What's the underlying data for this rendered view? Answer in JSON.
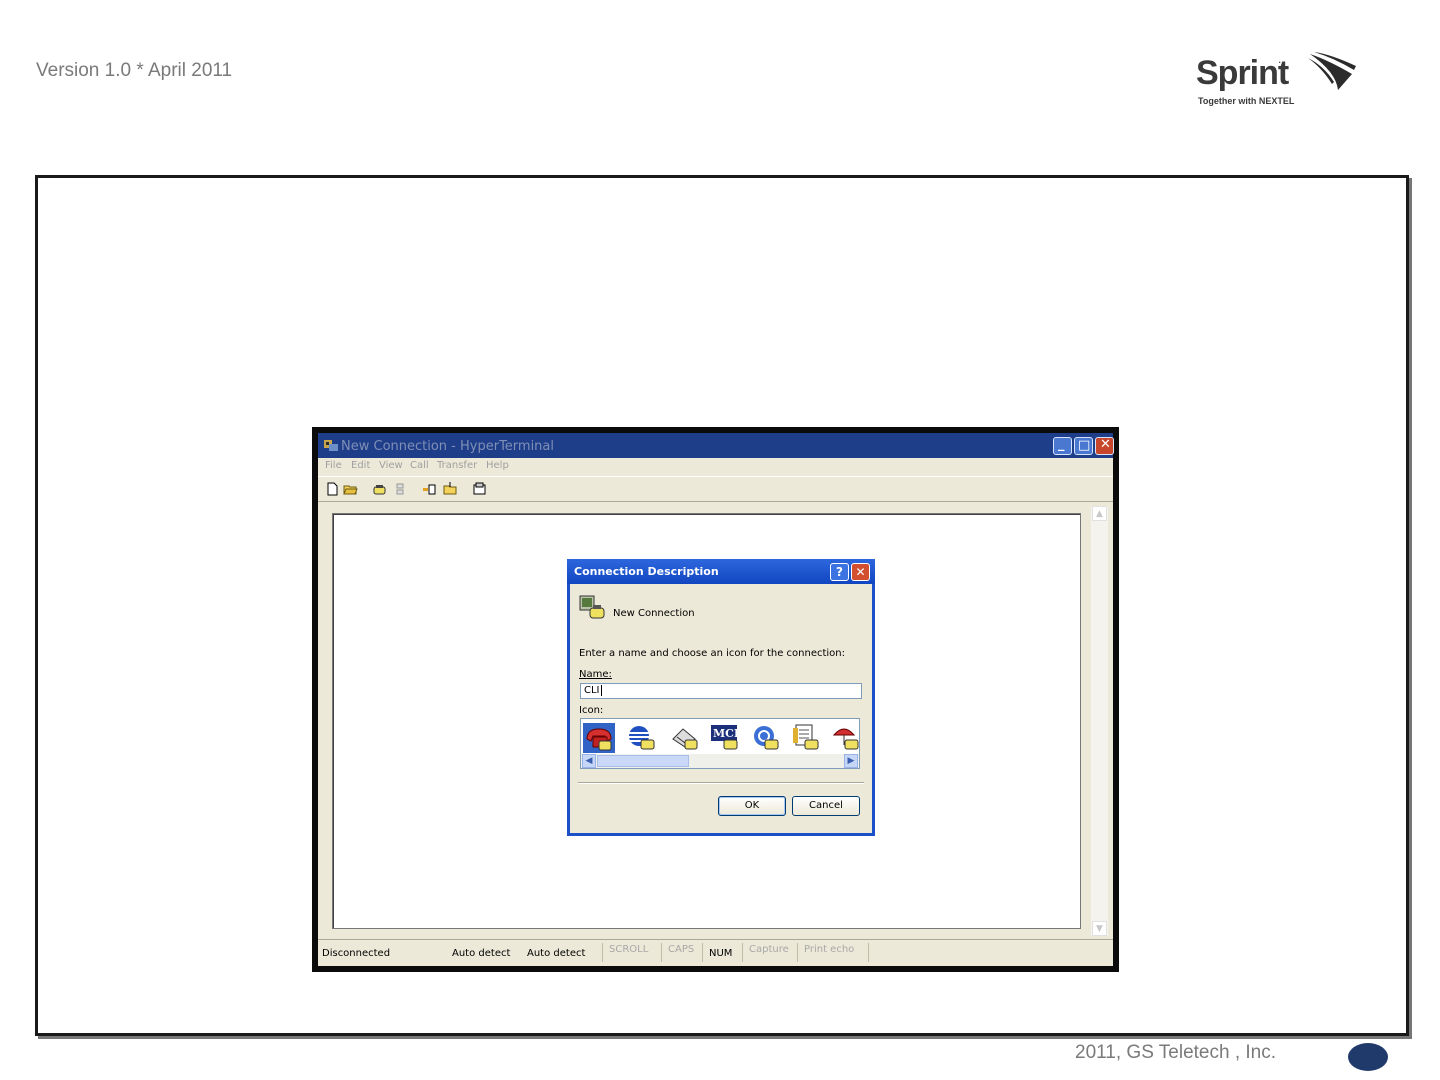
{
  "page": {
    "version_text": "Version 1.0 * April 2011",
    "footer_text": "2011, GS Teletech , Inc.",
    "logo": {
      "word": "Sprint",
      "trademark": ".",
      "tagline": "Together with NEXTEL"
    }
  },
  "window": {
    "title": "New Connection - HyperTerminal",
    "menu": [
      "File",
      "Edit",
      "View",
      "Call",
      "Transfer",
      "Help"
    ],
    "toolbar_icons": [
      "new-document-icon",
      "open-folder-icon",
      "dial-phone-icon",
      "disconnect-icon",
      "send-file-icon",
      "receive-file-icon",
      "properties-icon"
    ],
    "status": {
      "connection": "Disconnected",
      "detect1": "Auto detect",
      "detect2": "Auto detect",
      "scroll": "SCROLL",
      "caps": "CAPS",
      "num": "NUM",
      "capture": "Capture",
      "print_echo": "Print echo"
    }
  },
  "dialog": {
    "title": "Connection Description",
    "help_label": "?",
    "close_label": "✕",
    "connection_name_heading": "New Connection",
    "prompt": "Enter a name and choose an icon for the connection:",
    "name_label": "Name:",
    "name_value": "CLI",
    "icon_label": "Icon:",
    "icons": [
      "red-phone-icon",
      "globe-phone-icon",
      "fax-phone-icon",
      "mci-phone-icon",
      "at-globe-phone-icon",
      "document-phone-icon",
      "umbrella-phone-icon"
    ],
    "ok_label": "OK",
    "cancel_label": "Cancel"
  },
  "colors": {
    "titlebar": "#1e3e8a",
    "dialog_title": "#1b50c8",
    "page_badge": "#1f3a6b"
  }
}
